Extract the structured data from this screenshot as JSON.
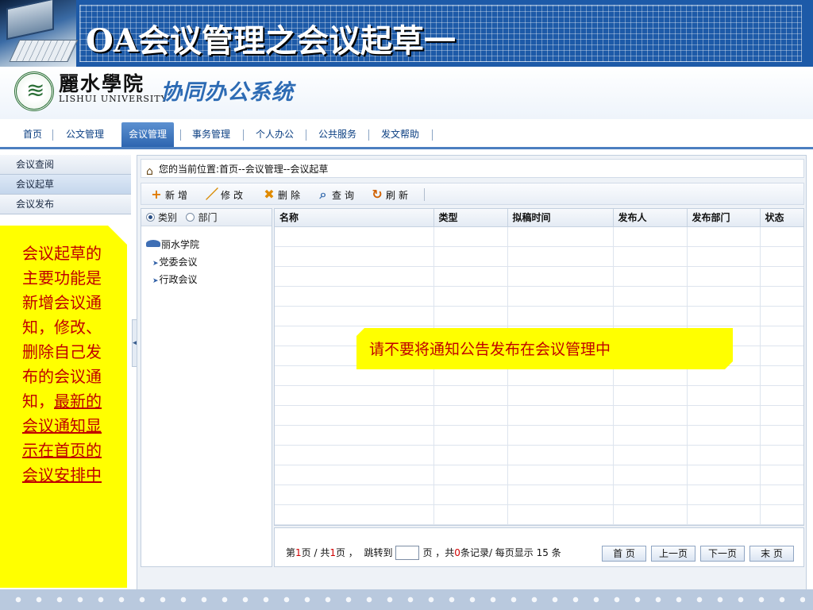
{
  "slide": {
    "title": "OA会议管理之会议起草一"
  },
  "banner": {
    "school_cn": "麗水學院",
    "school_en": "LISHUI UNIVERSITY",
    "system_title": "协同办公系统"
  },
  "nav": {
    "items": [
      {
        "label": "首页"
      },
      {
        "label": "公文管理"
      },
      {
        "label": "会议管理"
      },
      {
        "label": "事务管理"
      },
      {
        "label": "个人办公"
      },
      {
        "label": "公共服务"
      },
      {
        "label": "发文帮助"
      }
    ],
    "active": "会议管理"
  },
  "sidebar": {
    "items": [
      {
        "label": "会议查阅"
      },
      {
        "label": "会议起草"
      },
      {
        "label": "会议发布"
      }
    ],
    "active": "会议起草"
  },
  "breadcrumb": "您的当前位置:首页--会议管理--会议起草",
  "toolbar": {
    "add": "新增",
    "edit": "修改",
    "delete": "删除",
    "query": "查询",
    "refresh": "刷新"
  },
  "tree": {
    "radio_category": "类别",
    "radio_department": "部门",
    "selected_radio": "类别",
    "root": "丽水学院",
    "children": [
      "党委会议",
      "行政会议"
    ]
  },
  "grid": {
    "columns": [
      "名称",
      "类型",
      "拟稿时间",
      "发布人",
      "发布部门",
      "状态"
    ]
  },
  "pager": {
    "page_prefix": "第",
    "page_current": "1",
    "page_mid": "页 / 共",
    "page_total": "1",
    "page_suffix": "页 ，",
    "jump_label": "跳转到",
    "records_prefix": "页 ，共",
    "records_count": "0",
    "records_suffix": "条记录/ 每页显示",
    "per_page": "15 条",
    "first": "首 页",
    "prev": "上一页",
    "next": "下一页",
    "last": "末 页"
  },
  "notes": {
    "left_plain": "会议起草的主要功能是新增会议通知，修改、删除自己发布的会议通知，",
    "left_underlined": "最新的会议通知显示在首页的会议安排中",
    "center": "请不要将通知公告发布在会议管理中"
  },
  "colors": {
    "slide_blue": "#1d5aa8",
    "nav_active": "#2d65b0",
    "callout_yellow": "#ffff00",
    "callout_text": "#c00000"
  }
}
